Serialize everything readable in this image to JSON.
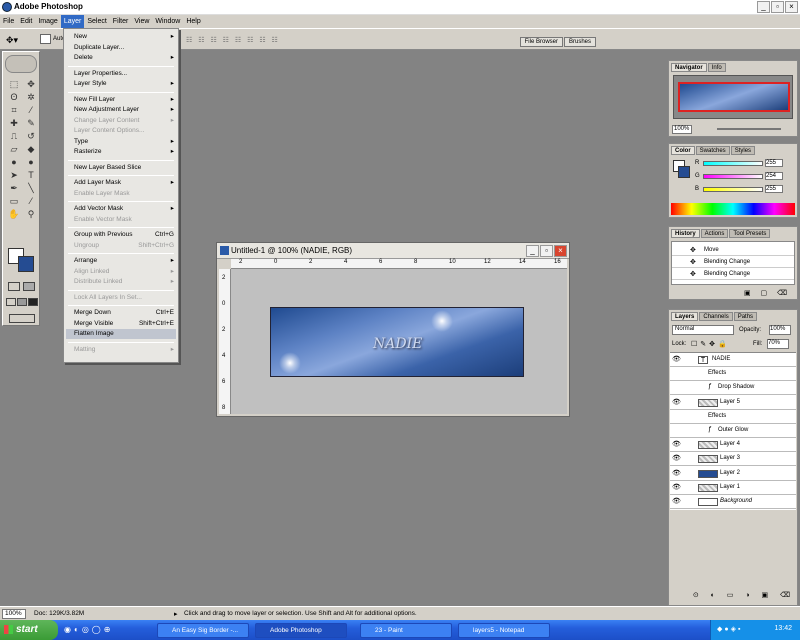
{
  "app": {
    "title": "Adobe Photoshop"
  },
  "menubar": [
    "File",
    "Edit",
    "Image",
    "Layer",
    "Select",
    "Filter",
    "View",
    "Window",
    "Help"
  ],
  "palette_well": [
    "File Browser",
    "Brushes"
  ],
  "options_bar": {
    "auto_select": "Auto"
  },
  "layer_menu": [
    {
      "label": "New",
      "arrow": true
    },
    {
      "label": "Duplicate Layer..."
    },
    {
      "label": "Delete",
      "arrow": true
    },
    {
      "sep": true
    },
    {
      "label": "Layer Properties..."
    },
    {
      "label": "Layer Style",
      "arrow": true
    },
    {
      "sep": true
    },
    {
      "label": "New Fill Layer",
      "arrow": true
    },
    {
      "label": "New Adjustment Layer",
      "arrow": true
    },
    {
      "label": "Change Layer Content",
      "arrow": true,
      "disabled": true
    },
    {
      "label": "Layer Content Options...",
      "disabled": true
    },
    {
      "label": "Type",
      "arrow": true
    },
    {
      "label": "Rasterize",
      "arrow": true
    },
    {
      "sep": true
    },
    {
      "label": "New Layer Based Slice"
    },
    {
      "sep": true
    },
    {
      "label": "Add Layer Mask",
      "arrow": true
    },
    {
      "label": "Enable Layer Mask",
      "disabled": true
    },
    {
      "sep": true
    },
    {
      "label": "Add Vector Mask",
      "arrow": true
    },
    {
      "label": "Enable Vector Mask",
      "disabled": true
    },
    {
      "sep": true
    },
    {
      "label": "Group with Previous",
      "shortcut": "Ctrl+G"
    },
    {
      "label": "Ungroup",
      "shortcut": "Shift+Ctrl+G",
      "disabled": true
    },
    {
      "sep": true
    },
    {
      "label": "Arrange",
      "arrow": true
    },
    {
      "label": "Align Linked",
      "arrow": true,
      "disabled": true
    },
    {
      "label": "Distribute Linked",
      "arrow": true,
      "disabled": true
    },
    {
      "sep": true
    },
    {
      "label": "Lock All Layers In Set...",
      "disabled": true
    },
    {
      "sep": true
    },
    {
      "label": "Merge Down",
      "shortcut": "Ctrl+E"
    },
    {
      "label": "Merge Visible",
      "shortcut": "Shift+Ctrl+E"
    },
    {
      "label": "Flatten Image",
      "highlight": true
    },
    {
      "sep": true
    },
    {
      "label": "Matting",
      "arrow": true,
      "disabled": true
    }
  ],
  "document": {
    "title": "Untitled-1 @ 100% (NADIE, RGB)",
    "ruler_h": [
      "2",
      "0",
      "2",
      "4",
      "6",
      "8",
      "10",
      "12",
      "14",
      "16"
    ],
    "ruler_v": [
      "2",
      "0",
      "2",
      "4",
      "6",
      "8"
    ],
    "signature_text": "NADIE"
  },
  "navigator": {
    "tabs": [
      "Navigator",
      "Info"
    ],
    "zoom": "100%"
  },
  "color": {
    "tabs": [
      "Color",
      "Swatches",
      "Styles"
    ],
    "r": "255",
    "g": "254",
    "b": "255",
    "r_label": "R",
    "g_label": "G",
    "b_label": "B"
  },
  "history": {
    "tabs": [
      "History",
      "Actions",
      "Tool Presets"
    ],
    "items": [
      "Move",
      "Blending Change",
      "Blending Change"
    ]
  },
  "layers": {
    "tabs": [
      "Layers",
      "Channels",
      "Paths"
    ],
    "blend_mode": "Normal",
    "opacity_label": "Opacity:",
    "opacity": "100%",
    "lock_label": "Lock:",
    "fill_label": "Fill:",
    "fill": "70%",
    "rows": [
      {
        "label": "NADIE",
        "type": "text"
      },
      {
        "label": "Effects",
        "sub": true
      },
      {
        "label": "Drop Shadow",
        "sub2": true
      },
      {
        "label": "Layer 5",
        "type": "layer"
      },
      {
        "label": "Effects",
        "sub": true
      },
      {
        "label": "Outer Glow",
        "sub2": true
      },
      {
        "label": "Layer 4",
        "type": "layer"
      },
      {
        "label": "Layer 3",
        "type": "layer"
      },
      {
        "label": "Layer 2",
        "type": "layer"
      },
      {
        "label": "Layer 1",
        "type": "layer"
      },
      {
        "label": "Background",
        "type": "bg"
      }
    ]
  },
  "status": {
    "zoom": "100%",
    "doc": "Doc: 129K/3.82M",
    "hint": "Click and drag to move layer or selection. Use Shift and Alt for additional options."
  },
  "taskbar": {
    "start": "start",
    "tasks": [
      "An Easy Sig Border -...",
      "Adobe Photoshop",
      "23 - Paint",
      "layers5 - Notepad"
    ],
    "clock": "13:42"
  },
  "colors": {
    "accent": "#316ac5",
    "xp_blue": "#245edb",
    "start_green": "#3a9b35"
  }
}
